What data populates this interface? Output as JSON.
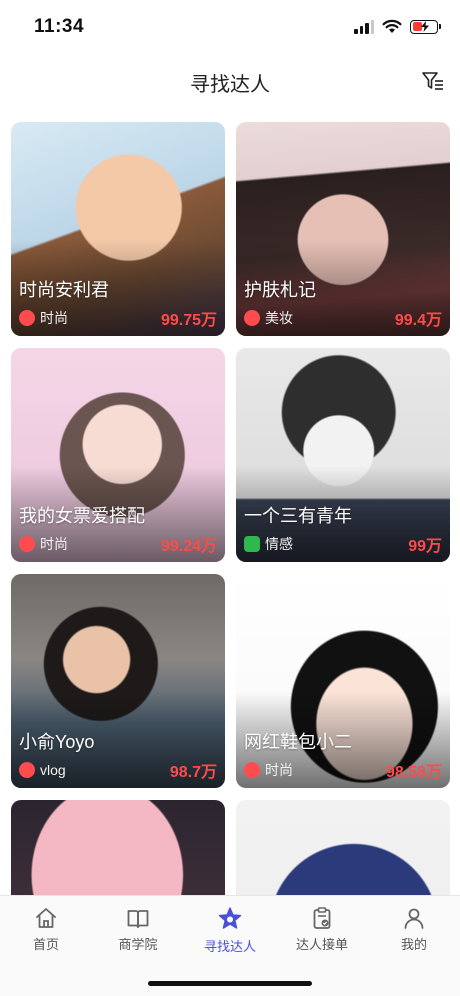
{
  "status_bar": {
    "time": "11:34"
  },
  "header": {
    "title": "寻找达人"
  },
  "icons": {
    "filter": "filter-icon",
    "weibo": "weibo-icon",
    "wechat": "wechat-icon",
    "home": "home-icon",
    "book": "book-icon",
    "star": "star-icon",
    "clipboard": "clipboard-check-icon",
    "user": "user-icon"
  },
  "colors": {
    "accent": "#4a50d8",
    "fans_red": "#ff4a4a",
    "weibo_red": "#ff4d4f",
    "wechat_green": "#2fb84c"
  },
  "influencers": [
    {
      "name": "时尚安利君",
      "platform": "weibo",
      "category": "时尚",
      "fans": "99.75万"
    },
    {
      "name": "护肤札记",
      "platform": "weibo",
      "category": "美妆",
      "fans": "99.4万"
    },
    {
      "name": "我的女票爱搭配",
      "platform": "weibo",
      "category": "时尚",
      "fans": "99.24万"
    },
    {
      "name": "一个三有青年",
      "platform": "wechat",
      "category": "情感",
      "fans": "99万"
    },
    {
      "name": "小俞Yoyo",
      "platform": "weibo",
      "category": "vlog",
      "fans": "98.7万"
    },
    {
      "name": "网红鞋包小二",
      "platform": "weibo",
      "category": "时尚",
      "fans": "98.58万"
    },
    {
      "name": "",
      "platform": "",
      "category": "",
      "fans": ""
    },
    {
      "name": "",
      "platform": "",
      "category": "",
      "fans": ""
    }
  ],
  "tab_bar": {
    "items": [
      {
        "label": "首页",
        "icon": "home-icon",
        "active": false
      },
      {
        "label": "商学院",
        "icon": "book-icon",
        "active": false
      },
      {
        "label": "寻找达人",
        "icon": "star-icon",
        "active": true
      },
      {
        "label": "达人接单",
        "icon": "clipboard-check-icon",
        "active": false
      },
      {
        "label": "我的",
        "icon": "user-icon",
        "active": false
      }
    ]
  }
}
